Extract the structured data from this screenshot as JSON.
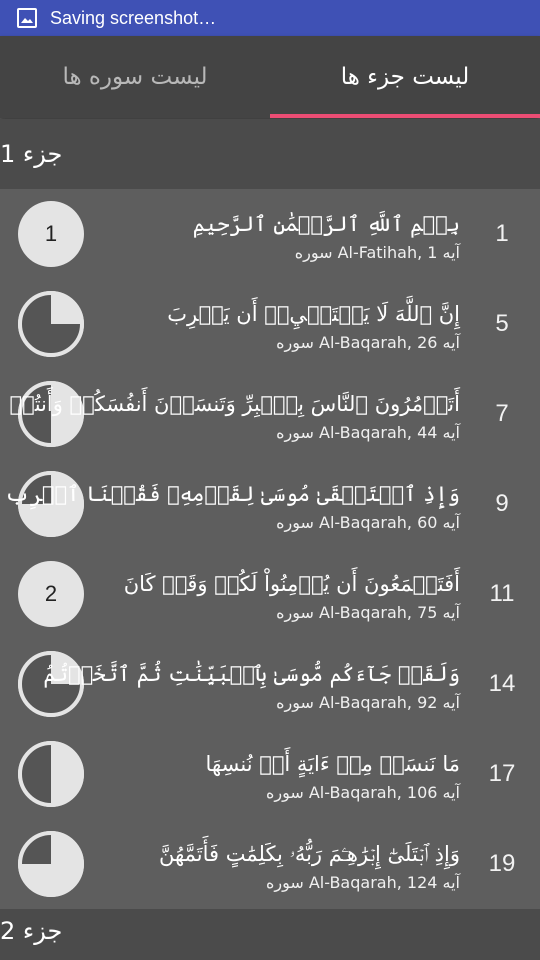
{
  "status_bar": {
    "title": "Saving screenshot…",
    "icon": "image-icon"
  },
  "tabs": [
    {
      "label": "لیست سوره ها",
      "active": false
    },
    {
      "label": "لیست جزء ها",
      "active": true
    }
  ],
  "colors": {
    "accent": "#ec4d74",
    "status_bar": "#3f51b5",
    "tab_bar": "#444444",
    "background": "#5e5e5e"
  },
  "juz_headers": [
    "جزء 1",
    "جزء 2"
  ],
  "rows": [
    {
      "number": "1",
      "arabic": "بِسۡمِ ٱللَّهِ ٱلرَّحۡمَٰنِ ٱلرَّحِيمِ",
      "sub": "سوره Al-Fatihah,  آیه 1",
      "badge": "1",
      "progress": 0
    },
    {
      "number": "5",
      "arabic": "إِنَّ ٱللَّهَ لَا يَسۡتَحۡيِۦٓ أَن يَضۡرِبَ",
      "sub": "سوره Al-Baqarah,  آیه 26",
      "badge": "",
      "progress": 0.25
    },
    {
      "number": "7",
      "arabic": "أَتَأۡمُرُونَ ٱلنَّاسَ بِٱلۡبِرِّ وَتَنسَوۡنَ أَنفُسَكُمۡ وَأَنتُمۡ",
      "sub": "سوره Al-Baqarah,  آیه 44",
      "badge": "",
      "progress": 0.5
    },
    {
      "number": "9",
      "arabic": "وَإِذِ ٱسۡتَسۡقَىٰ مُوسَىٰ لِقَوۡمِهِۦ فَقُلۡنَا ٱضۡرِب",
      "sub": "سوره Al-Baqarah,  آیه 60",
      "badge": "",
      "progress": 0.75
    },
    {
      "number": "11",
      "arabic": "أَفَتَطۡمَعُونَ أَن يُؤۡمِنُواْ لَكُمۡ وَقَدۡ كَانَ",
      "sub": "سوره Al-Baqarah,  آیه 75",
      "badge": "2",
      "progress": 0
    },
    {
      "number": "14",
      "arabic": "وَلَقَدۡ جَآءَكُم مُّوسَىٰ بِٱلۡبَيِّنَٰتِ ثُمَّ ٱتَّخَذۡتُمُ",
      "sub": "سوره Al-Baqarah,  آیه 92",
      "badge": "",
      "progress": 0.25
    },
    {
      "number": "17",
      "arabic": "مَا نَنسَخۡ مِنۡ ءَايَةٍ أَوۡ نُنسِهَا",
      "sub": "سوره Al-Baqarah,  آیه 106",
      "badge": "",
      "progress": 0.5
    },
    {
      "number": "19",
      "arabic": "وَإِذِ ٱبۡتَلَىٰٓ إِبۡرَٰهِـۧمَ رَبُّهُۥ بِكَلِمَٰتٍ فَأَتَمَّهُنَّ",
      "sub": "سوره Al-Baqarah,  آیه 124",
      "badge": "",
      "progress": 0.75
    }
  ]
}
